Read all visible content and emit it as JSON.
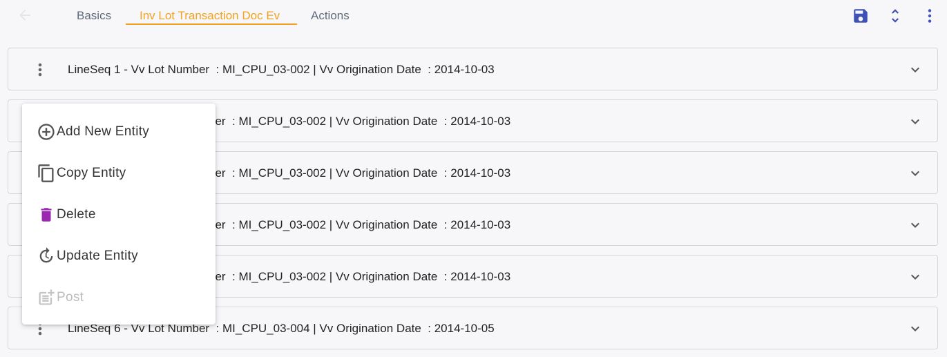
{
  "tabs": [
    {
      "label": "Basics",
      "active": false
    },
    {
      "label": "Inv Lot Transaction Doc Ev",
      "active": true
    },
    {
      "label": "Actions",
      "active": false
    }
  ],
  "toolbar": {
    "back_icon": "arrow-left-icon",
    "save_icon": "save-icon",
    "expand_icon": "unfold-more-icon",
    "more_icon": "more-vert-icon"
  },
  "rows": [
    {
      "text": "LineSeq 1 - Vv Lot Number  : MI_CPU_03-002 | Vv Origination Date  : 2014-10-03"
    },
    {
      "text": "ber  : MI_CPU_03-002 | Vv Origination Date  : 2014-10-03"
    },
    {
      "text": "ber  : MI_CPU_03-002 | Vv Origination Date  : 2014-10-03"
    },
    {
      "text": "ber  : MI_CPU_03-002 | Vv Origination Date  : 2014-10-03"
    },
    {
      "text": "ber  : MI_CPU_03-002 | Vv Origination Date  : 2014-10-03"
    },
    {
      "text": "LineSeq 6 - Vv Lot Number  : MI_CPU_03-004 | Vv Origination Date  : 2014-10-05"
    }
  ],
  "context_menu": {
    "items": [
      {
        "label": "Add New Entity",
        "icon": "add-circle-icon",
        "disabled": false
      },
      {
        "label": "Copy Entity",
        "icon": "copy-icon",
        "disabled": false
      },
      {
        "label": "Delete",
        "icon": "trash-icon",
        "disabled": false
      },
      {
        "label": "Update Entity",
        "icon": "refresh-icon",
        "disabled": false
      },
      {
        "label": "Post",
        "icon": "post-add-icon",
        "disabled": true
      }
    ]
  },
  "colors": {
    "accent": "#f4a21e",
    "primary_icon": "#3f51b5",
    "delete_icon": "#9c27b0",
    "disabled": "#bdbdbd"
  }
}
